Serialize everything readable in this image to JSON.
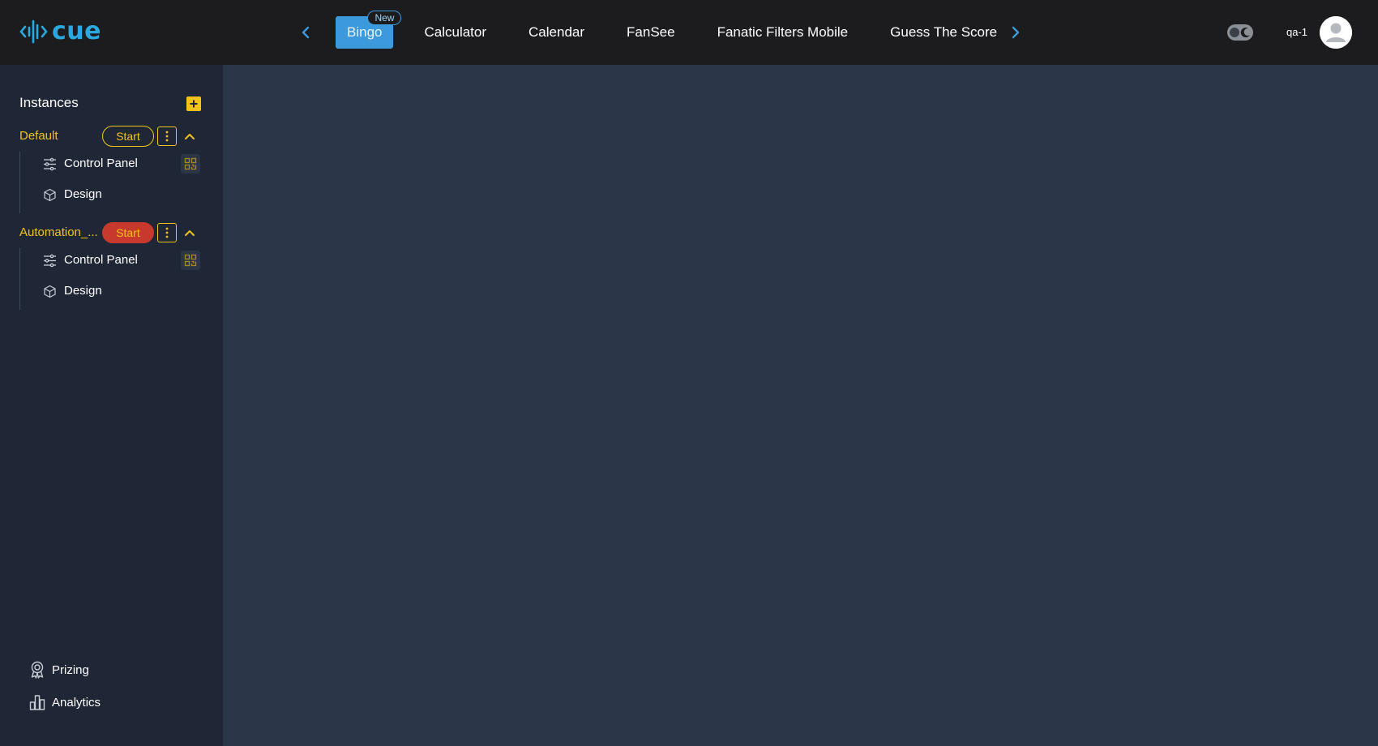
{
  "brand": {
    "name": "cue"
  },
  "colors": {
    "accent": "#3b99dc",
    "warning": "#f2c318",
    "danger": "#c6392c"
  },
  "header": {
    "tabs": [
      {
        "label": "Bingo",
        "badge": "New",
        "active": true
      },
      {
        "label": "Calculator"
      },
      {
        "label": "Calendar"
      },
      {
        "label": "FanSee"
      },
      {
        "label": "Fanatic Filters Mobile"
      },
      {
        "label": "Guess The Score"
      }
    ],
    "username": "qa-1"
  },
  "sidebar": {
    "title": "Instances",
    "instances": [
      {
        "name": "Default",
        "start_label": "Start",
        "start_style": "outline",
        "items": [
          {
            "label": "Control Panel",
            "icon": "sliders-icon"
          },
          {
            "label": "Design",
            "icon": "cube-icon"
          }
        ]
      },
      {
        "name": "Automation_...",
        "start_label": "Start",
        "start_style": "filled",
        "items": [
          {
            "label": "Control Panel",
            "icon": "sliders-icon"
          },
          {
            "label": "Design",
            "icon": "cube-icon"
          }
        ]
      }
    ],
    "bottom": [
      {
        "label": "Prizing",
        "icon": "award-icon"
      },
      {
        "label": "Analytics",
        "icon": "bar-chart-icon"
      }
    ]
  }
}
